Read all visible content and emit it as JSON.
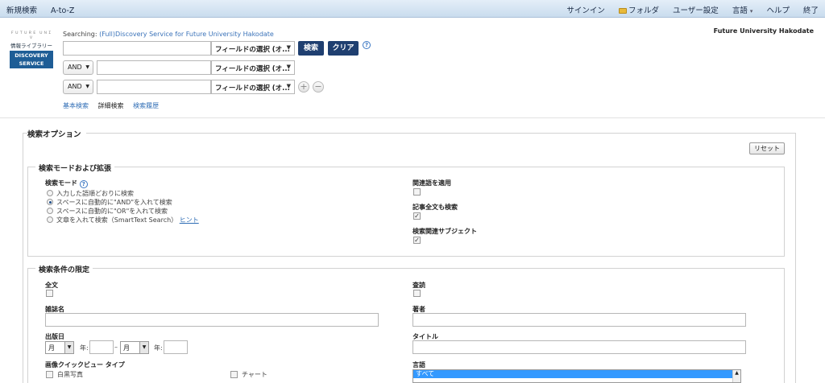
{
  "topbar": {
    "left": [
      "新規検索",
      "A-to-Z"
    ],
    "signin": "サインイン",
    "folder": "フォルダ",
    "user_settings": "ユーザー設定",
    "language": "言語",
    "help": "ヘルプ",
    "exit": "終了"
  },
  "logo": {
    "small": "ＦＵＴＵＲＥ ＵＮＩＶ",
    "name": "情報ライブラリー",
    "line1": "DISCOVERY",
    "line2": "SERVICE"
  },
  "searching": {
    "label": "Searching: ",
    "db": "(Full)Discovery Service for Future University Hakodate"
  },
  "university": "Future University Hakodate",
  "search": {
    "field_select": "フィールドの選択 (オ...",
    "search_btn": "検索",
    "clear_btn": "クリア",
    "help": "?",
    "op1": "AND",
    "op2": "AND",
    "plus": "+",
    "minus": "−"
  },
  "links": {
    "basic": "基本検索",
    "advanced": "詳細検索",
    "history": "検索履歴"
  },
  "options": {
    "title": "検索オプション",
    "reset": "リセット",
    "mode_section": "検索モードおよび拡張",
    "mode_label": "検索モード",
    "modes": [
      "入力した語順どおりに検索",
      "スペースに自動的に\"AND\"を入れて検索",
      "スペースに自動的に\"OR\"を入れて検索",
      "文章を入れて検索（SmartText Search）"
    ],
    "hint": "ヒント",
    "related_words": "関連語を適用",
    "fulltext_articles": "記事全文も検索",
    "related_subjects": "検索関連サブジェクト",
    "limit_section": "検索条件の限定",
    "fulltext": "全文",
    "peer": "査読",
    "journal": "雑誌名",
    "author": "著者",
    "pubdate": "出版日",
    "title_label": "タイトル",
    "month": "月",
    "year": "年:",
    "dash": "–",
    "image_type": "画像クイックビュー タイプ",
    "bw_photo": "白黒写真",
    "chart": "チャート",
    "lang_label": "言語",
    "lang_all": "すべて"
  }
}
